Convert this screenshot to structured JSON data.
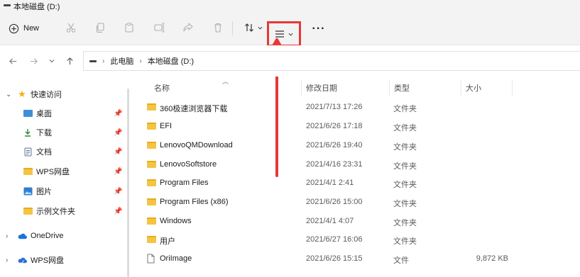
{
  "window": {
    "title": "本地磁盘 (D:)"
  },
  "toolbar": {
    "new_label": "New",
    "icons": [
      "cut-icon",
      "copy-icon",
      "paste-icon",
      "rename-icon",
      "share-icon",
      "delete-icon",
      "sort-icon",
      "view-icon",
      "more-icon"
    ],
    "highlight_color": "#e53935"
  },
  "address": {
    "parts": [
      "此电脑",
      "本地磁盘 (D:)"
    ]
  },
  "sidebar": {
    "quick_access": "快速访问",
    "items": [
      {
        "label": "桌面",
        "icon": "desktop-icon"
      },
      {
        "label": "下载",
        "icon": "download-icon"
      },
      {
        "label": "文档",
        "icon": "document-icon"
      },
      {
        "label": "WPS网盘",
        "icon": "folder-icon"
      },
      {
        "label": "图片",
        "icon": "pictures-icon"
      },
      {
        "label": "示例文件夹",
        "icon": "folder-icon"
      }
    ],
    "onedrive": "OneDrive",
    "wps": "WPS网盘"
  },
  "columns": {
    "name": "名称",
    "date": "修改日期",
    "type": "类型",
    "size": "大小"
  },
  "files": [
    {
      "name": "360极速浏览器下载",
      "date": "2021/7/13 17:26",
      "type": "文件夹",
      "size": ""
    },
    {
      "name": "EFI",
      "date": "2021/6/26 17:18",
      "type": "文件夹",
      "size": ""
    },
    {
      "name": "LenovoQMDownload",
      "date": "2021/6/26 19:40",
      "type": "文件夹",
      "size": ""
    },
    {
      "name": "LenovoSoftstore",
      "date": "2021/4/16 23:31",
      "type": "文件夹",
      "size": ""
    },
    {
      "name": "Program Files",
      "date": "2021/4/1 2:41",
      "type": "文件夹",
      "size": ""
    },
    {
      "name": "Program Files (x86)",
      "date": "2021/6/26 15:00",
      "type": "文件夹",
      "size": ""
    },
    {
      "name": "Windows",
      "date": "2021/4/1 4:07",
      "type": "文件夹",
      "size": ""
    },
    {
      "name": "用户",
      "date": "2021/6/27 16:06",
      "type": "文件夹",
      "size": ""
    },
    {
      "name": "OriImage",
      "date": "2021/6/26 15:15",
      "type": "文件",
      "size": "9,872 KB"
    }
  ]
}
